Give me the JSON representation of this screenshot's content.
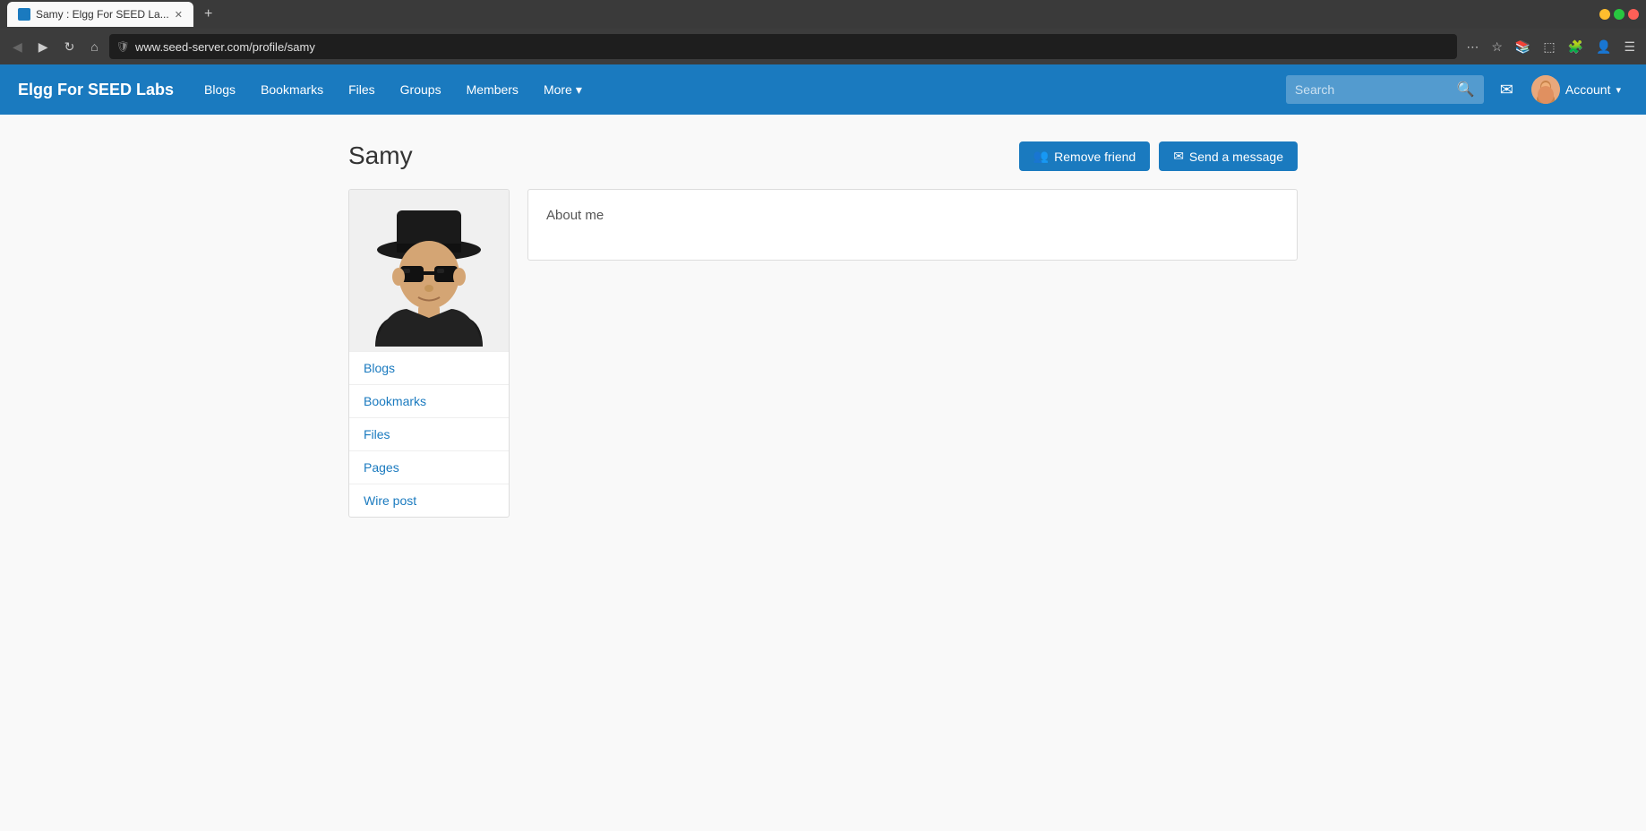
{
  "browser": {
    "tab_title": "Samy : Elgg For SEED La...",
    "tab_favicon": "E",
    "url": "www.seed-server.com/profile/samy",
    "nav_buttons": {
      "back": "◀",
      "forward": "▶",
      "refresh": "↻",
      "home": "⌂"
    },
    "toolbar_icons": {
      "more_icon": "⋯",
      "shield_icon": "🛡",
      "star_icon": "☆",
      "extensions_icon": "🧩",
      "bookmarks_icon": "📚",
      "profile_icon": "👤",
      "menu_icon": "☰"
    }
  },
  "navbar": {
    "brand": "Elgg For SEED Labs",
    "links": [
      {
        "label": "Blogs",
        "href": "#"
      },
      {
        "label": "Bookmarks",
        "href": "#"
      },
      {
        "label": "Files",
        "href": "#"
      },
      {
        "label": "Groups",
        "href": "#"
      },
      {
        "label": "Members",
        "href": "#"
      },
      {
        "label": "More",
        "href": "#",
        "has_dropdown": true
      }
    ],
    "search_placeholder": "Search",
    "account_label": "Account",
    "account_dropdown": true
  },
  "profile": {
    "name": "Samy",
    "actions": {
      "remove_friend_label": "Remove friend",
      "send_message_label": "Send a message"
    },
    "sidebar_links": [
      {
        "label": "Blogs"
      },
      {
        "label": "Bookmarks"
      },
      {
        "label": "Files"
      },
      {
        "label": "Pages"
      },
      {
        "label": "Wire post"
      }
    ],
    "about_me_label": "About me"
  }
}
